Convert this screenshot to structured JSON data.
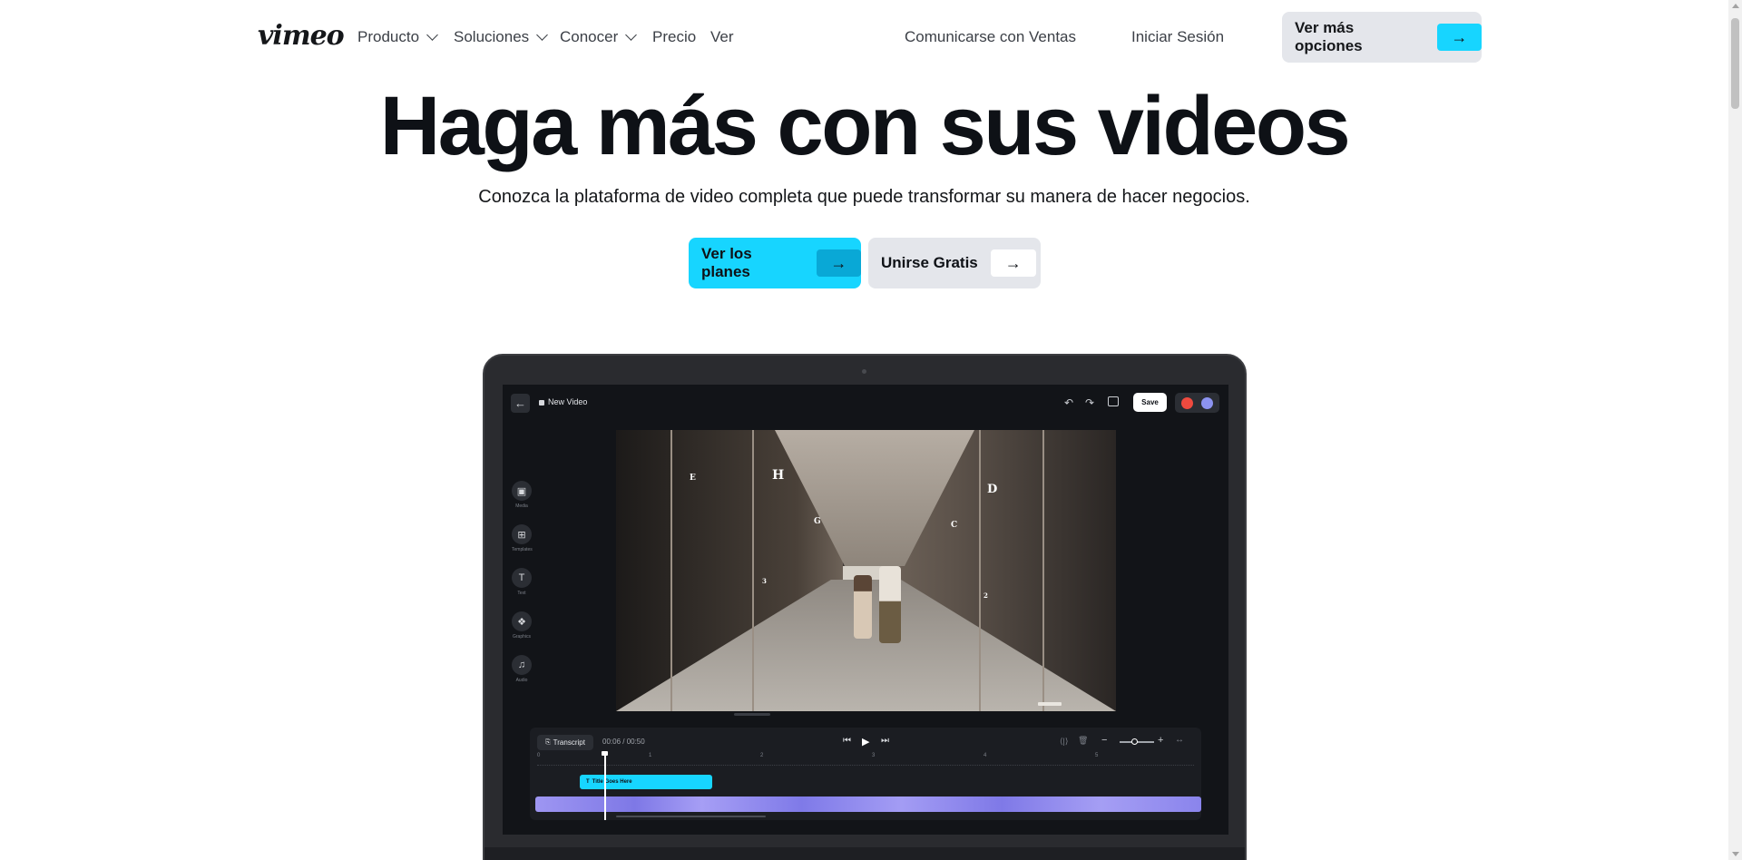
{
  "nav": {
    "logo": "vimeo",
    "items": [
      {
        "label": "Producto"
      },
      {
        "label": "Soluciones"
      },
      {
        "label": "Conocer"
      },
      {
        "label": "Precio"
      },
      {
        "label": "Ver"
      }
    ],
    "contact_sales": "Comunicarse con Ventas",
    "login": "Iniciar Sesión",
    "more_options": "Ver más opciones",
    "arrow": "→"
  },
  "hero": {
    "title": "Haga más con sus videos",
    "subtitle": "Conozca la plataforma de video completa que puede transformar su manera de hacer negocios.",
    "primary_cta": "Ver los planes",
    "secondary_cta": "Unirse Gratis",
    "arrow": "→"
  },
  "editor": {
    "back_icon": "←",
    "project_title": "New Video",
    "undo_icon": "↶",
    "redo_icon": "↷",
    "save_label": "Save",
    "tools": [
      {
        "label": "Media",
        "icon": "▣"
      },
      {
        "label": "Templates",
        "icon": "⊞"
      },
      {
        "label": "Text",
        "icon": "T"
      },
      {
        "label": "Graphics",
        "icon": "❖"
      },
      {
        "label": "Audio",
        "icon": "♫"
      }
    ],
    "video_signs": [
      "H",
      "D",
      "G",
      "C",
      "E",
      "3",
      "2"
    ],
    "timeline": {
      "transcript_label": "Transcript",
      "time": "00:06 / 00:50",
      "prev_icon": "⏮",
      "play_icon": "▶",
      "next_icon": "⏭",
      "split_icon": "⟨|⟩",
      "trash_icon": "🗑",
      "zoom_out": "−",
      "zoom_in": "+",
      "fit_icon": "↔",
      "ticks": [
        "0",
        "1",
        "2",
        "3",
        "4",
        "5"
      ],
      "title_clip": "Title Goes Here",
      "title_clip_icon": "T"
    }
  },
  "colors": {
    "accent": "#17d5ff",
    "button_gray": "#e4e6eb",
    "laptop_body": "#2a2b2f",
    "screen_bg": "#121418",
    "video_track": "#8c93f0"
  }
}
